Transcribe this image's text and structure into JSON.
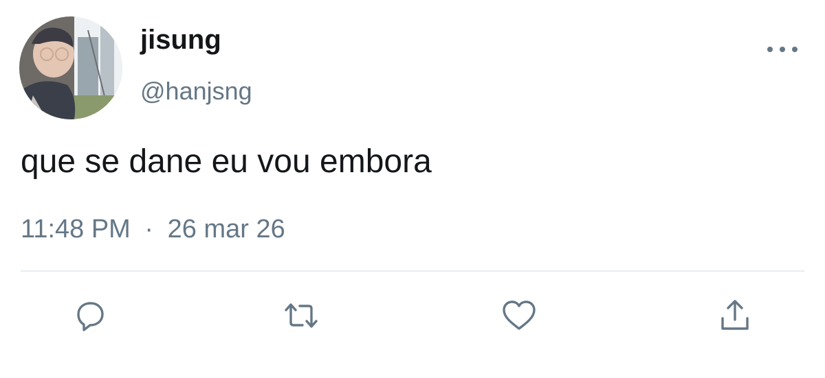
{
  "tweet": {
    "display_name": "jisung",
    "handle": "@hanjsng",
    "text": "que se dane eu vou embora",
    "time": "11:48 PM",
    "separator": "·",
    "date": "26 mar 26"
  },
  "icons": {
    "avatar": "profile-photo",
    "more": "more-options-icon",
    "reply": "reply-icon",
    "retweet": "retweet-icon",
    "like": "heart-icon",
    "share": "share-icon"
  },
  "colors": {
    "text_primary": "#14171a",
    "text_secondary": "#657786",
    "divider": "#e6ecf0"
  }
}
